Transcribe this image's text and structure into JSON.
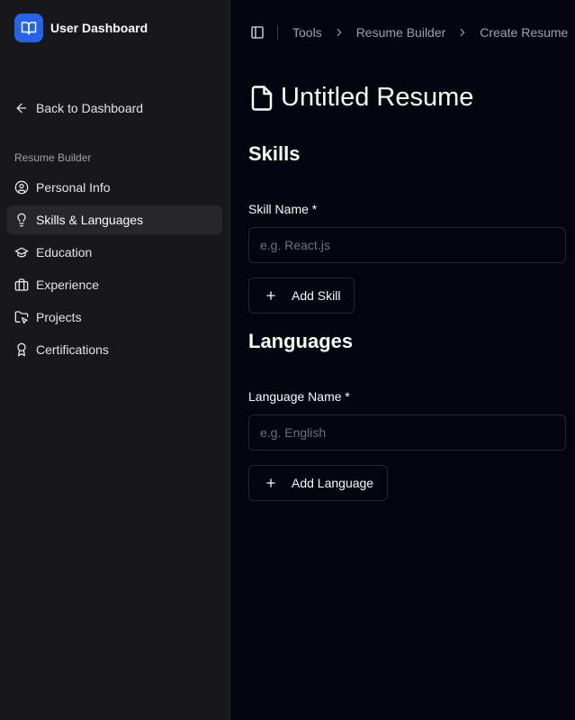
{
  "brand": {
    "title": "User Dashboard",
    "icon": "book-open-icon",
    "color": "#2563eb"
  },
  "sidebar": {
    "back_label": "Back to Dashboard",
    "group_label": "Resume Builder",
    "items": [
      {
        "label": "Personal Info",
        "icon": "user-circle-icon"
      },
      {
        "label": "Skills & Languages",
        "icon": "lightbulb-icon",
        "active": true
      },
      {
        "label": "Education",
        "icon": "graduation-cap-icon"
      },
      {
        "label": "Experience",
        "icon": "briefcase-icon"
      },
      {
        "label": "Projects",
        "icon": "folder-cursor-icon"
      },
      {
        "label": "Certifications",
        "icon": "award-icon"
      }
    ]
  },
  "breadcrumb": [
    "Tools",
    "Resume Builder",
    "Create Resume"
  ],
  "page": {
    "title": "Untitled Resume",
    "icon": "file-icon"
  },
  "skills": {
    "heading": "Skills",
    "field_label": "Skill Name *",
    "placeholder": "e.g. React.js",
    "value": "",
    "add_label": "Add Skill"
  },
  "languages": {
    "heading": "Languages",
    "field_label": "Language Name *",
    "placeholder": "e.g. English",
    "value": "",
    "add_label": "Add Language"
  }
}
